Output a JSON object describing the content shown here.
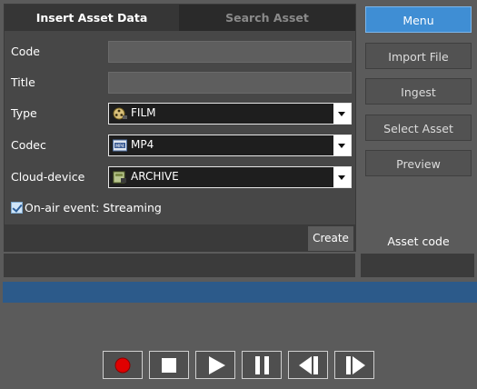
{
  "tabs": [
    {
      "label": "Insert Asset Data",
      "active": true
    },
    {
      "label": "Search Asset",
      "active": false
    }
  ],
  "form": {
    "code_label": "Code",
    "code_value": "",
    "title_label": "Title",
    "title_value": "",
    "type_label": "Type",
    "type_value": "FILM",
    "type_icon": "film-reel-icon",
    "codec_label": "Codec",
    "codec_value": "MP4",
    "codec_icon": "mp4-file-icon",
    "cloud_label": "Cloud-device",
    "cloud_value": "ARCHIVE",
    "cloud_icon": "archive-icon",
    "onair_label": "On-air event: Streaming",
    "onair_checked": true,
    "create_label": "Create"
  },
  "menu": {
    "menu_label": "Menu",
    "items": [
      "Import File",
      "Ingest",
      "Select Asset",
      "Preview"
    ],
    "asset_code_label": "Asset code"
  },
  "player": {
    "buttons": [
      "record-icon",
      "stop-icon",
      "play-icon",
      "pause-icon",
      "step-back-icon",
      "step-forward-icon"
    ]
  },
  "colors": {
    "accent": "#3f8ed4",
    "record": "#e00000",
    "progress_bar": "#2c5a8a"
  }
}
